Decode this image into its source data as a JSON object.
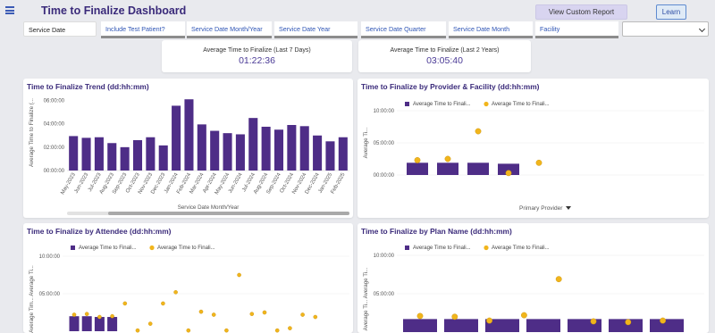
{
  "header": {
    "title": "Time to Finalize Dashboard",
    "view_custom_report": "View Custom Report",
    "learn": "Learn"
  },
  "filters": [
    "Service Date",
    "Include Test Patient?",
    "Service Date Month/Year",
    "Service Date Year",
    "Service Date Quarter",
    "Service Date Month",
    "Facility"
  ],
  "facility_select_value": "",
  "kpis": {
    "last7": {
      "label": "Average Time to Finalize (Last 7 Days)",
      "value": "01:22:36"
    },
    "last2y": {
      "label": "Average Time to Finalize (Last 2 Years)",
      "value": "03:05:40"
    }
  },
  "colors": {
    "bar": "#4e2d87",
    "dot": "#f1b51c",
    "accent": "#3a2a7a"
  },
  "icons": {
    "menu": "menu-icon",
    "dropdown": "chevron-down-icon",
    "sort": "caret-down-icon"
  },
  "chart_data": [
    {
      "type": "bar",
      "title": "Time to Finalize Trend (dd:hh:mm)",
      "xlabel": "Service Date Month/Year",
      "ylabel": "Average Time to Finalize (...",
      "y_ticks": [
        "00:00:00",
        "02:00:00",
        "04:00:00",
        "06:00:00"
      ],
      "ylim": [
        0,
        6.5
      ],
      "categories": [
        "May-2023",
        "Jun-2023",
        "Jul-2023",
        "Aug-2023",
        "Sep-2023",
        "Oct-2023",
        "Nov-2023",
        "Dec-2023",
        "Jan-2024",
        "Feb-2024",
        "Mar-2024",
        "Apr-2024",
        "May-2024",
        "Jun-2024",
        "Jul-2024",
        "Aug-2024",
        "Sep-2024",
        "Oct-2024",
        "Nov-2024",
        "Dec-2024",
        "Jan-2025",
        "Feb-2025"
      ],
      "values": [
        2.95,
        2.8,
        2.85,
        2.35,
        2.0,
        2.6,
        2.85,
        2.15,
        5.55,
        6.1,
        3.95,
        3.4,
        3.2,
        3.1,
        4.5,
        3.75,
        3.5,
        3.9,
        3.8,
        3.0,
        2.5,
        2.85
      ]
    },
    {
      "type": "bar",
      "title": "Time to Finalize by Provider & Facility (dd:hh:mm)",
      "xlabel": "Primary Provider",
      "ylabel": "Average Ti...",
      "y_ticks": [
        "00:00:00",
        "05:00:00",
        "10:00:00"
      ],
      "ylim": [
        0,
        10
      ],
      "legend": [
        "Average Time to Finali...",
        "Average Time to Finali..."
      ],
      "bars": [
        1.9,
        1.9,
        1.9,
        1.75,
        null
      ],
      "dots": [
        2.3,
        2.5,
        6.8,
        0.3,
        1.9
      ]
    },
    {
      "type": "bar",
      "title": "Time to Finalize by Attendee (dd:hh:mm)",
      "ylabel": "Average Tim... Average Ti...",
      "y_ticks": [
        "05:00:00",
        "10:00:00"
      ],
      "ylim": [
        0,
        10
      ],
      "legend": [
        "Average Time to Finali...",
        "Average Time to Finali..."
      ],
      "bars": [
        2.0,
        2.0,
        1.9,
        1.9,
        null,
        null,
        null,
        null,
        null,
        null,
        null,
        null,
        null,
        null,
        null,
        null,
        null,
        null,
        null,
        null
      ],
      "dots": [
        2.2,
        2.3,
        1.9,
        2.0,
        3.7,
        0.1,
        1.0,
        3.7,
        5.2,
        0.1,
        2.6,
        2.2,
        0.1,
        7.5,
        2.3,
        2.5,
        0.1,
        0.4,
        2.2,
        1.9
      ]
    },
    {
      "type": "bar",
      "title": "Time to Finalize by Plan Name (dd:hh:mm)",
      "ylabel": "Average Ti... Average Ti...",
      "y_ticks": [
        "05:00:00",
        "10:00:00"
      ],
      "ylim": [
        0,
        10
      ],
      "legend": [
        "Average Time to Finali...",
        "Average Time to Finali..."
      ],
      "bars": [
        1.7,
        1.7,
        1.7,
        1.7,
        1.7,
        1.7,
        1.7
      ],
      "dots": [
        2.1,
        2.0,
        1.5,
        2.2,
        6.9,
        1.4,
        1.3,
        1.5
      ]
    }
  ]
}
